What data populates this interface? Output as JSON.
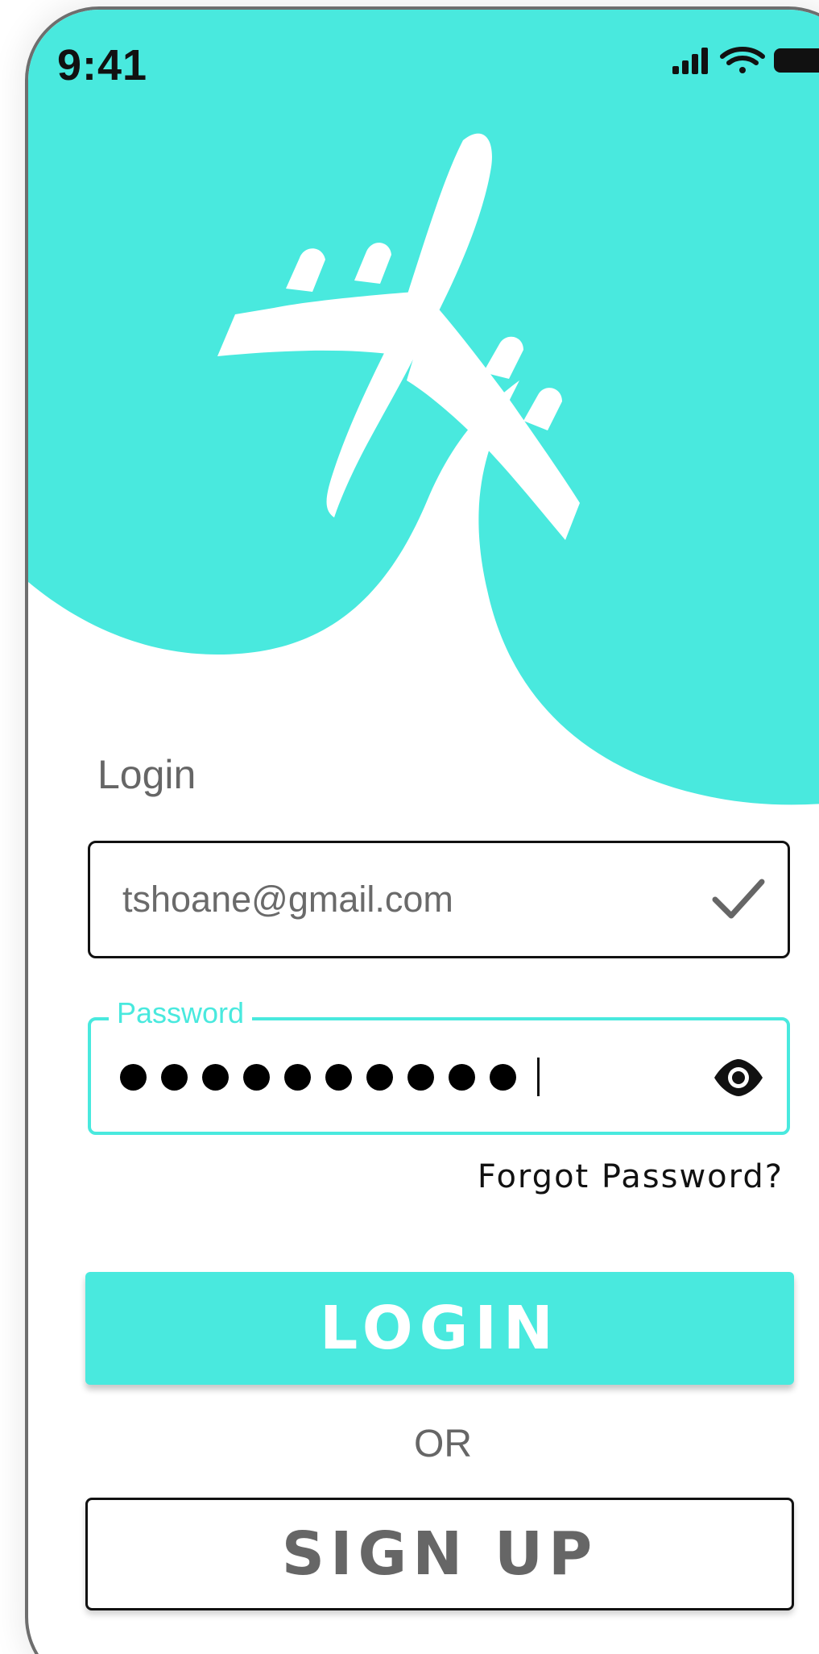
{
  "status_bar": {
    "time": "9:41",
    "icons": [
      "signal-icon",
      "wifi-icon",
      "battery-icon"
    ]
  },
  "hero": {
    "icon": "airplane-icon",
    "accent_color": "#49e9de"
  },
  "form": {
    "heading": "Login",
    "email": {
      "value": "tshoane@gmail.com",
      "status_icon": "check-icon"
    },
    "password": {
      "label": "Password",
      "masked_length": 10,
      "toggle_icon": "eye-icon"
    },
    "forgot_link": "Forgot Password?"
  },
  "actions": {
    "login_label": "LOGIN",
    "separator": "OR",
    "signup_label": "SIGN UP"
  },
  "colors": {
    "accent": "#49e9de",
    "text_muted": "#666666",
    "text_dark": "#111111"
  }
}
